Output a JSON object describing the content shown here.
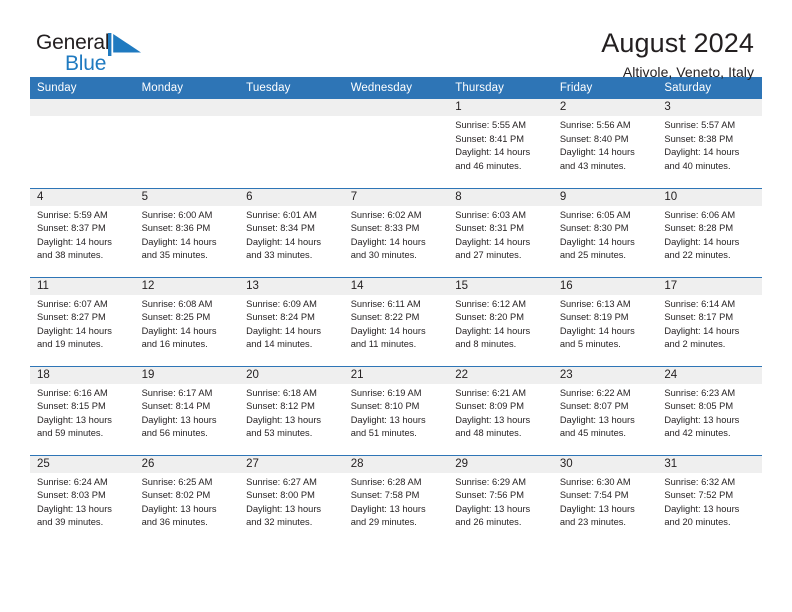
{
  "brand": {
    "name_part1": "General",
    "name_part2": "Blue",
    "logo_icon": "blue-triangle-flag-icon",
    "accent_color": "#1f7ac0"
  },
  "header": {
    "title": "August 2024",
    "location": "Altivole, Veneto, Italy"
  },
  "theme": {
    "header_blue": "#2e75b6",
    "daynum_band_gray": "#efefef",
    "text_color": "#231f20"
  },
  "weekdays": [
    "Sunday",
    "Monday",
    "Tuesday",
    "Wednesday",
    "Thursday",
    "Friday",
    "Saturday"
  ],
  "weeks": [
    [
      {
        "day": "",
        "sunrise": "",
        "sunset": "",
        "daylight_line1": "",
        "daylight_line2": ""
      },
      {
        "day": "",
        "sunrise": "",
        "sunset": "",
        "daylight_line1": "",
        "daylight_line2": ""
      },
      {
        "day": "",
        "sunrise": "",
        "sunset": "",
        "daylight_line1": "",
        "daylight_line2": ""
      },
      {
        "day": "",
        "sunrise": "",
        "sunset": "",
        "daylight_line1": "",
        "daylight_line2": ""
      },
      {
        "day": "1",
        "sunrise": "Sunrise: 5:55 AM",
        "sunset": "Sunset: 8:41 PM",
        "daylight_line1": "Daylight: 14 hours",
        "daylight_line2": "and 46 minutes."
      },
      {
        "day": "2",
        "sunrise": "Sunrise: 5:56 AM",
        "sunset": "Sunset: 8:40 PM",
        "daylight_line1": "Daylight: 14 hours",
        "daylight_line2": "and 43 minutes."
      },
      {
        "day": "3",
        "sunrise": "Sunrise: 5:57 AM",
        "sunset": "Sunset: 8:38 PM",
        "daylight_line1": "Daylight: 14 hours",
        "daylight_line2": "and 40 minutes."
      }
    ],
    [
      {
        "day": "4",
        "sunrise": "Sunrise: 5:59 AM",
        "sunset": "Sunset: 8:37 PM",
        "daylight_line1": "Daylight: 14 hours",
        "daylight_line2": "and 38 minutes."
      },
      {
        "day": "5",
        "sunrise": "Sunrise: 6:00 AM",
        "sunset": "Sunset: 8:36 PM",
        "daylight_line1": "Daylight: 14 hours",
        "daylight_line2": "and 35 minutes."
      },
      {
        "day": "6",
        "sunrise": "Sunrise: 6:01 AM",
        "sunset": "Sunset: 8:34 PM",
        "daylight_line1": "Daylight: 14 hours",
        "daylight_line2": "and 33 minutes."
      },
      {
        "day": "7",
        "sunrise": "Sunrise: 6:02 AM",
        "sunset": "Sunset: 8:33 PM",
        "daylight_line1": "Daylight: 14 hours",
        "daylight_line2": "and 30 minutes."
      },
      {
        "day": "8",
        "sunrise": "Sunrise: 6:03 AM",
        "sunset": "Sunset: 8:31 PM",
        "daylight_line1": "Daylight: 14 hours",
        "daylight_line2": "and 27 minutes."
      },
      {
        "day": "9",
        "sunrise": "Sunrise: 6:05 AM",
        "sunset": "Sunset: 8:30 PM",
        "daylight_line1": "Daylight: 14 hours",
        "daylight_line2": "and 25 minutes."
      },
      {
        "day": "10",
        "sunrise": "Sunrise: 6:06 AM",
        "sunset": "Sunset: 8:28 PM",
        "daylight_line1": "Daylight: 14 hours",
        "daylight_line2": "and 22 minutes."
      }
    ],
    [
      {
        "day": "11",
        "sunrise": "Sunrise: 6:07 AM",
        "sunset": "Sunset: 8:27 PM",
        "daylight_line1": "Daylight: 14 hours",
        "daylight_line2": "and 19 minutes."
      },
      {
        "day": "12",
        "sunrise": "Sunrise: 6:08 AM",
        "sunset": "Sunset: 8:25 PM",
        "daylight_line1": "Daylight: 14 hours",
        "daylight_line2": "and 16 minutes."
      },
      {
        "day": "13",
        "sunrise": "Sunrise: 6:09 AM",
        "sunset": "Sunset: 8:24 PM",
        "daylight_line1": "Daylight: 14 hours",
        "daylight_line2": "and 14 minutes."
      },
      {
        "day": "14",
        "sunrise": "Sunrise: 6:11 AM",
        "sunset": "Sunset: 8:22 PM",
        "daylight_line1": "Daylight: 14 hours",
        "daylight_line2": "and 11 minutes."
      },
      {
        "day": "15",
        "sunrise": "Sunrise: 6:12 AM",
        "sunset": "Sunset: 8:20 PM",
        "daylight_line1": "Daylight: 14 hours",
        "daylight_line2": "and 8 minutes."
      },
      {
        "day": "16",
        "sunrise": "Sunrise: 6:13 AM",
        "sunset": "Sunset: 8:19 PM",
        "daylight_line1": "Daylight: 14 hours",
        "daylight_line2": "and 5 minutes."
      },
      {
        "day": "17",
        "sunrise": "Sunrise: 6:14 AM",
        "sunset": "Sunset: 8:17 PM",
        "daylight_line1": "Daylight: 14 hours",
        "daylight_line2": "and 2 minutes."
      }
    ],
    [
      {
        "day": "18",
        "sunrise": "Sunrise: 6:16 AM",
        "sunset": "Sunset: 8:15 PM",
        "daylight_line1": "Daylight: 13 hours",
        "daylight_line2": "and 59 minutes."
      },
      {
        "day": "19",
        "sunrise": "Sunrise: 6:17 AM",
        "sunset": "Sunset: 8:14 PM",
        "daylight_line1": "Daylight: 13 hours",
        "daylight_line2": "and 56 minutes."
      },
      {
        "day": "20",
        "sunrise": "Sunrise: 6:18 AM",
        "sunset": "Sunset: 8:12 PM",
        "daylight_line1": "Daylight: 13 hours",
        "daylight_line2": "and 53 minutes."
      },
      {
        "day": "21",
        "sunrise": "Sunrise: 6:19 AM",
        "sunset": "Sunset: 8:10 PM",
        "daylight_line1": "Daylight: 13 hours",
        "daylight_line2": "and 51 minutes."
      },
      {
        "day": "22",
        "sunrise": "Sunrise: 6:21 AM",
        "sunset": "Sunset: 8:09 PM",
        "daylight_line1": "Daylight: 13 hours",
        "daylight_line2": "and 48 minutes."
      },
      {
        "day": "23",
        "sunrise": "Sunrise: 6:22 AM",
        "sunset": "Sunset: 8:07 PM",
        "daylight_line1": "Daylight: 13 hours",
        "daylight_line2": "and 45 minutes."
      },
      {
        "day": "24",
        "sunrise": "Sunrise: 6:23 AM",
        "sunset": "Sunset: 8:05 PM",
        "daylight_line1": "Daylight: 13 hours",
        "daylight_line2": "and 42 minutes."
      }
    ],
    [
      {
        "day": "25",
        "sunrise": "Sunrise: 6:24 AM",
        "sunset": "Sunset: 8:03 PM",
        "daylight_line1": "Daylight: 13 hours",
        "daylight_line2": "and 39 minutes."
      },
      {
        "day": "26",
        "sunrise": "Sunrise: 6:25 AM",
        "sunset": "Sunset: 8:02 PM",
        "daylight_line1": "Daylight: 13 hours",
        "daylight_line2": "and 36 minutes."
      },
      {
        "day": "27",
        "sunrise": "Sunrise: 6:27 AM",
        "sunset": "Sunset: 8:00 PM",
        "daylight_line1": "Daylight: 13 hours",
        "daylight_line2": "and 32 minutes."
      },
      {
        "day": "28",
        "sunrise": "Sunrise: 6:28 AM",
        "sunset": "Sunset: 7:58 PM",
        "daylight_line1": "Daylight: 13 hours",
        "daylight_line2": "and 29 minutes."
      },
      {
        "day": "29",
        "sunrise": "Sunrise: 6:29 AM",
        "sunset": "Sunset: 7:56 PM",
        "daylight_line1": "Daylight: 13 hours",
        "daylight_line2": "and 26 minutes."
      },
      {
        "day": "30",
        "sunrise": "Sunrise: 6:30 AM",
        "sunset": "Sunset: 7:54 PM",
        "daylight_line1": "Daylight: 13 hours",
        "daylight_line2": "and 23 minutes."
      },
      {
        "day": "31",
        "sunrise": "Sunrise: 6:32 AM",
        "sunset": "Sunset: 7:52 PM",
        "daylight_line1": "Daylight: 13 hours",
        "daylight_line2": "and 20 minutes."
      }
    ]
  ]
}
